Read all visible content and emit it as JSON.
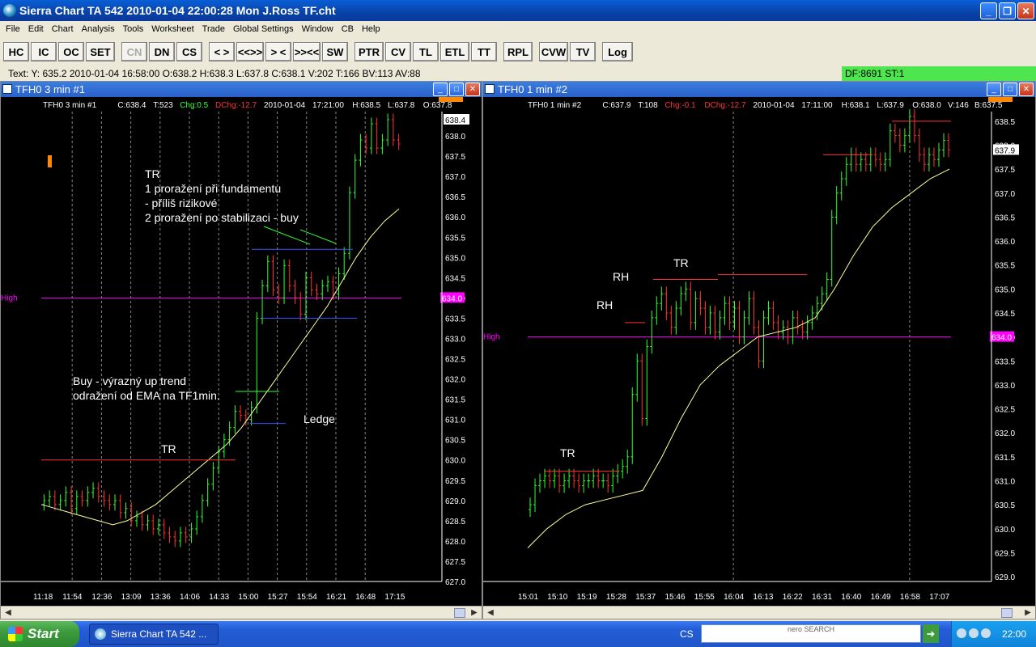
{
  "window": {
    "title": "Sierra Chart TA 542   2010-01-04  22:00:28  Mon   J.Ross TF.cht"
  },
  "menu": [
    "File",
    "Edit",
    "Chart",
    "Analysis",
    "Tools",
    "Worksheet",
    "Trade",
    "Global Settings",
    "Window",
    "CB",
    "Help"
  ],
  "toolbar": [
    {
      "label": "HC",
      "w": 32
    },
    {
      "label": "IC",
      "w": 32
    },
    {
      "label": "OC",
      "w": 32
    },
    {
      "label": "SET",
      "w": 36
    },
    {
      "gap": true
    },
    {
      "label": "CN",
      "w": 32,
      "disabled": true
    },
    {
      "label": "DN",
      "w": 32
    },
    {
      "label": "CS",
      "w": 32
    },
    {
      "gap": true
    },
    {
      "label": "< >",
      "w": 32
    },
    {
      "label": "<<>>",
      "w": 34
    },
    {
      "label": "> <",
      "w": 32
    },
    {
      "label": ">><<",
      "w": 34
    },
    {
      "label": "SW",
      "w": 32
    },
    {
      "gap": true
    },
    {
      "label": "PTR",
      "w": 36
    },
    {
      "label": "CV",
      "w": 32
    },
    {
      "label": "TL",
      "w": 32
    },
    {
      "label": "ETL",
      "w": 36
    },
    {
      "label": "TT",
      "w": 32
    },
    {
      "gap": true
    },
    {
      "label": "RPL",
      "w": 36
    },
    {
      "gap": true
    },
    {
      "label": "CVW",
      "w": 36
    },
    {
      "label": "TV",
      "w": 32
    },
    {
      "gap": true
    },
    {
      "label": "Log",
      "w": 38
    }
  ],
  "status": {
    "text": "Text: Y: 635.2  2010-01-04  16:58:00  O:638.2  H:638.3  L:637.8  C:638.1  V:202  T:166  BV:113  AV:88",
    "right": "DF:8691   ST:1"
  },
  "colors": {
    "bg": "#000000",
    "up": "#33ff33",
    "down": "#ff3333",
    "ema": "#ffff99",
    "magenta": "#ff00ff",
    "red_line": "#ff3333",
    "blue_line": "#3355ff",
    "text": "#ffffff",
    "axis": "#ffffff"
  },
  "charts": [
    {
      "title": "TFH0  3 min   #1",
      "header": {
        "sym": "TFH0  3 min   #1",
        "c": "C:638.4",
        "t": "T:523",
        "chg": "Chg:0.5",
        "dchg": "DChg:-12.7",
        "date": "2010-01-04",
        "time": "17:21:00",
        "h": "H:638.5",
        "l": "L:637.8",
        "o": "O:637.8"
      },
      "price_labels": [
        "638.4",
        "638.0",
        "637.5",
        "637.0",
        "636.5",
        "636.0",
        "635.5",
        "635.0",
        "634.5",
        "634.0",
        "633.5",
        "633.0",
        "632.5",
        "632.0",
        "631.5",
        "631.0",
        "630.5",
        "630.0",
        "629.5",
        "629.0",
        "628.5",
        "628.0",
        "627.5",
        "627.0"
      ],
      "time_labels": [
        "11:18",
        "11:54",
        "12:36",
        "13:09",
        "13:36",
        "14:06",
        "14:33",
        "15:00",
        "15:27",
        "15:54",
        "16:21",
        "16:48",
        "17:15"
      ],
      "high_label": "High",
      "high_value": "634.0",
      "last_price": "638.4",
      "annotations": [
        "TR",
        "1 proražení při fundamentu",
        " - příliš rizikové",
        "2 proražení po stabilizaci - buy",
        "Buy - výrazný up trend",
        "odražení od EMA na TF1min.",
        "TR",
        "Ledge"
      ],
      "chart_data": {
        "type": "candlestick",
        "ylim": [
          627.0,
          638.6
        ],
        "high_line": 634.0,
        "closes": [
          629.0,
          629.1,
          628.9,
          629.0,
          629.2,
          628.8,
          629.1,
          629.0,
          629.2,
          629.3,
          629.1,
          629.0,
          628.9,
          629.0,
          628.7,
          628.8,
          628.5,
          628.6,
          628.4,
          628.5,
          628.3,
          628.4,
          628.2,
          628.1,
          628.0,
          628.2,
          628.1,
          628.3,
          628.6,
          629.0,
          629.4,
          629.8,
          630.2,
          630.5,
          630.8,
          631.2,
          631.1,
          631.0,
          631.3,
          633.5,
          634.3,
          634.9,
          634.2,
          634.0,
          634.8,
          634.3,
          634.0,
          633.6,
          634.5,
          634.2,
          634.1,
          634.3,
          634.4,
          634.1,
          634.6,
          635.1,
          636.6,
          637.4,
          637.9,
          637.7,
          638.3,
          637.7,
          637.9,
          638.4,
          637.9,
          637.8
        ],
        "ema": [
          628.9,
          628.8,
          628.7,
          628.6,
          628.5,
          628.4,
          628.5,
          628.7,
          628.9,
          629.2,
          629.5,
          629.8,
          630.1,
          630.4,
          630.8,
          631.3,
          631.8,
          632.3,
          632.8,
          633.3,
          633.8,
          634.4,
          635.0,
          635.5,
          635.9,
          636.2
        ],
        "lines": [
          {
            "y": 630.0,
            "color": "red"
          },
          {
            "y": 635.2,
            "color": "blue"
          },
          {
            "y": 633.5,
            "color": "blue"
          },
          {
            "y": 630.9,
            "color": "blue"
          }
        ]
      }
    },
    {
      "title": "TFH0  1 min   #2",
      "header": {
        "sym": "TFH0  1 min   #2",
        "c": "C:637.9",
        "t": "T:108",
        "chg": "Chg:-0.1",
        "dchg": "DChg:-12.7",
        "date": "2010-01-04",
        "time": "17:11:00",
        "h": "H:638.1",
        "l": "L:637.9",
        "o": "O:638.0",
        "v": "V:146",
        "b": "B:637.5"
      },
      "price_labels": [
        "638.5",
        "638.0",
        "637.9",
        "637.5",
        "637.0",
        "636.5",
        "636.0",
        "635.5",
        "635.0",
        "634.5",
        "634.0",
        "633.5",
        "633.0",
        "632.5",
        "632.0",
        "631.5",
        "631.0",
        "630.5",
        "630.0",
        "629.5",
        "629.0"
      ],
      "time_labels": [
        "15:01",
        "15:10",
        "15:19",
        "15:28",
        "15:37",
        "15:46",
        "15:55",
        "16:04",
        "16:13",
        "16:22",
        "16:31",
        "16:40",
        "16:49",
        "16:58",
        "17:07"
      ],
      "high_label": "High",
      "high_value": "634.0",
      "last_price": "637.9",
      "annotations": [
        "TR",
        "RH",
        "RH",
        "TR"
      ],
      "chart_data": {
        "type": "candlestick",
        "ylim": [
          628.9,
          638.7
        ],
        "high_line": 634.0,
        "closes": [
          630.5,
          630.9,
          631.0,
          631.1,
          631.0,
          631.1,
          630.9,
          631.0,
          631.1,
          631.0,
          630.9,
          631.0,
          631.0,
          631.1,
          631.0,
          631.0,
          630.9,
          631.1,
          631.2,
          631.3,
          631.5,
          632.8,
          633.5,
          632.3,
          633.8,
          634.4,
          634.7,
          634.9,
          634.5,
          634.2,
          634.6,
          634.9,
          635.0,
          634.3,
          634.8,
          634.6,
          634.2,
          634.5,
          634.1,
          634.4,
          634.7,
          634.3,
          634.6,
          634.0,
          634.4,
          634.8,
          634.2,
          633.5,
          634.4,
          634.6,
          634.3,
          634.1,
          634.2,
          634.0,
          634.4,
          634.2,
          634.1,
          634.3,
          634.5,
          634.7,
          634.9,
          635.2,
          636.5,
          637.0,
          637.3,
          637.6,
          637.8,
          637.6,
          637.7,
          637.6,
          637.8,
          637.7,
          637.6,
          637.7,
          638.3,
          638.2,
          638.0,
          638.2,
          638.6,
          638.2,
          637.8,
          637.6,
          637.8,
          637.7,
          637.9,
          638.1,
          637.9
        ],
        "ema": [
          629.6,
          630.0,
          630.3,
          630.5,
          630.6,
          630.7,
          630.8,
          631.5,
          632.3,
          633.0,
          633.4,
          633.7,
          634.0,
          634.1,
          634.2,
          634.4,
          635.0,
          635.7,
          636.3,
          636.7,
          637.0,
          637.3,
          637.5
        ]
      }
    }
  ],
  "taskbar": {
    "start": "Start",
    "item": "Sierra Chart TA 542 ...",
    "cs": "CS",
    "nero": "nero SEARCH",
    "clock": "22:00"
  }
}
